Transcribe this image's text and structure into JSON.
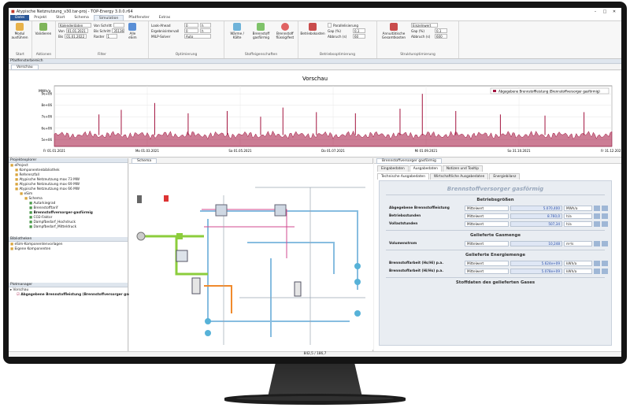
{
  "window": {
    "title": "Atypische Netznutzung_v30.tar-proj - TOP-Energy 3.0.0.r64"
  },
  "ribbon": {
    "tabs": [
      "Datei",
      "Projekt",
      "Start",
      "Schema",
      "Simulation",
      "Pfadfenster",
      "Extras"
    ],
    "active_tab": "Simulation",
    "start": {
      "label": "Start",
      "button": "Modul ausführen"
    },
    "aktionen": {
      "label": "Aktionen",
      "button": "Validieren"
    },
    "filter": {
      "label": "Filter",
      "kalender": "Kalenderdaten",
      "von_label": "Von",
      "von_value": "01.01.2021",
      "bis_label": "Bis",
      "bis_value": "01.01.2022",
      "von_schritt": "Von Schritt",
      "bis_schritt": "Bis Schritt",
      "bis_value2": "35136",
      "raster": "Raster",
      "raster_value": "1",
      "alle": "Alle eSim"
    },
    "optimierung": {
      "label": "Optimierung",
      "look_ahead": "Look-Ahead",
      "look_ahead_value": "0",
      "look_ahead_unit": "h",
      "ergebnis": "Ergebnisintervall",
      "ergebnis_value": "0",
      "ergebnis_unit": "h",
      "milp": "MILP-Solver",
      "milp_value": "Auto"
    },
    "stoff": {
      "label": "Stoffeigenschaften",
      "b1": "Wärme / Kälte",
      "b2": "Brennstoff gasförmig",
      "b3": "Brennstoff flüssig/fest"
    },
    "betrieb": {
      "label": "Betriebsoptimierung",
      "kosten": "Betriebskosten",
      "parallel": "Parallelisierung",
      "gap": "Gap (%)",
      "gap_value": "0,1",
      "abbruch": "Abbruch (s)",
      "abbruch_value": "60"
    },
    "struktur": {
      "label": "Strukturoptimierung",
      "annuitaet": "Annuitätische Gesamtkosten",
      "kriterium": "Einzelnwert",
      "gap": "Gap (%)",
      "gap_value": "0,1",
      "abbruch": "Abbruch (s)",
      "abbruch_value": "600"
    }
  },
  "panels": {
    "pfad": "Pfadfensterbereich",
    "vorschau_tab": "Vorschau",
    "projekt": "Projektexplorer",
    "bibliotheken": "Bibliotheken",
    "plotmanager": "Plotmanager",
    "schema_tab": "Schema",
    "props_tab": "Brennstoffversorger gasförmig"
  },
  "chart_data": {
    "type": "line",
    "title": "Vorschau",
    "ylabel": "MWh/a",
    "legend": "Abgegebene Brennstoffleistung (Brennstoffversorger gasförmig)",
    "legend_position": "top-right",
    "y_ticks": [
      "5e+06",
      "6e+06",
      "7e+06",
      "8e+06",
      "9e+06"
    ],
    "ylim": [
      4400000,
      9700000
    ],
    "x_ticks": [
      "Fr 01.01.2021",
      "Mo 01.03.2021",
      "Sa 01.05.2021",
      "Do 01.07.2021",
      "Mi 01.09.2021",
      "So 31.10.2021",
      "Fr 31.12.2021"
    ],
    "baseline": 5400000,
    "spikes": [
      {
        "x": 0.08,
        "y": 7200000
      },
      {
        "x": 0.12,
        "y": 7600000
      },
      {
        "x": 0.18,
        "y": 8200000
      },
      {
        "x": 0.24,
        "y": 7300000
      },
      {
        "x": 0.31,
        "y": 7500000
      },
      {
        "x": 0.37,
        "y": 7000000
      },
      {
        "x": 0.41,
        "y": 7800000
      },
      {
        "x": 0.47,
        "y": 7400000
      },
      {
        "x": 0.54,
        "y": 7300000
      },
      {
        "x": 0.62,
        "y": 7700000
      },
      {
        "x": 0.66,
        "y": 9000000
      },
      {
        "x": 0.72,
        "y": 7500000
      },
      {
        "x": 0.8,
        "y": 7200000
      },
      {
        "x": 0.88,
        "y": 7100000
      },
      {
        "x": 0.95,
        "y": 7400000
      }
    ],
    "color": "#a3133e",
    "grid": true
  },
  "tree": [
    {
      "label": "eProject",
      "level": 0
    },
    {
      "label": "Komponentenbibliothek",
      "level": 1
    },
    {
      "label": "Referenzfall",
      "level": 1
    },
    {
      "label": "Atypische Netznutzung max 73 MW",
      "level": 1
    },
    {
      "label": "Atypische Netznutzung max 69 MW",
      "level": 1
    },
    {
      "label": "Atypische Netznutzung max 66 MW",
      "level": 1
    },
    {
      "label": "eSim",
      "level": 2
    },
    {
      "label": "Schema",
      "level": 3
    },
    {
      "label": "Autarkiegrad",
      "level": 4
    },
    {
      "label": "Brennstofftarif",
      "level": 4
    },
    {
      "label": "Brennstoffversorger-gasförmig",
      "level": 4,
      "bold": true
    },
    {
      "label": "CO2-Faktor",
      "level": 4
    },
    {
      "label": "Dampfbedarf_Hochdruck",
      "level": 4
    },
    {
      "label": "Dampfbedarf_Mitteldruck",
      "level": 4
    }
  ],
  "libraries": [
    "eSim-Komponentenvorlagen",
    "Eigene Komponenten"
  ],
  "plots": {
    "group": "Vorschau",
    "item": "Abgegebene Brennstoffleistung (Brennstoffversorger gasförmig)"
  },
  "props": {
    "outer_tabs": [
      "Eingabedaten",
      "Ausgabedaten",
      "Notizen und Tooltip"
    ],
    "inner_tabs": [
      "Technische Ausgabedaten",
      "Wirtschaftliche Ausgabedaten",
      "Energiebilanz"
    ],
    "heading": "Brennstoffversorger gasförmig",
    "sections": [
      {
        "title": "Betriebsgrößen",
        "rows": [
          {
            "label": "Abgegebene Brennstoffleistung",
            "mode": "Mittelwert",
            "value": "5.070,400",
            "unit": "MWh/a"
          },
          {
            "label": "Betriebsstunden",
            "mode": "Mittelwert",
            "value": "8.760,0",
            "unit": "h/a"
          },
          {
            "label": "Vollaststunden",
            "mode": "Mittelwert",
            "value": "507,34",
            "unit": "h/a"
          }
        ]
      },
      {
        "title": "Gelieferte Gasmenge",
        "rows": [
          {
            "label": "Volumenstrom",
            "mode": "Mittelwert",
            "value": "10,248",
            "unit": "m³/s"
          }
        ]
      },
      {
        "title": "Gelieferte Energiemenge",
        "rows": [
          {
            "label": "Brennstoffarbeit (Hs/Hi) p.a.",
            "mode": "Mittelwert",
            "value": "5.624e+09",
            "unit": "kWh/a"
          },
          {
            "label": "Brennstoffarbeit (Hi/Hs) p.a.",
            "mode": "Mittelwert",
            "value": "5.078e+09",
            "unit": "kWh/a"
          }
        ]
      },
      {
        "title": "Stoffdaten des gelieferten Gases",
        "rows": []
      }
    ]
  },
  "status": {
    "text": "842,5 / 186,7"
  }
}
